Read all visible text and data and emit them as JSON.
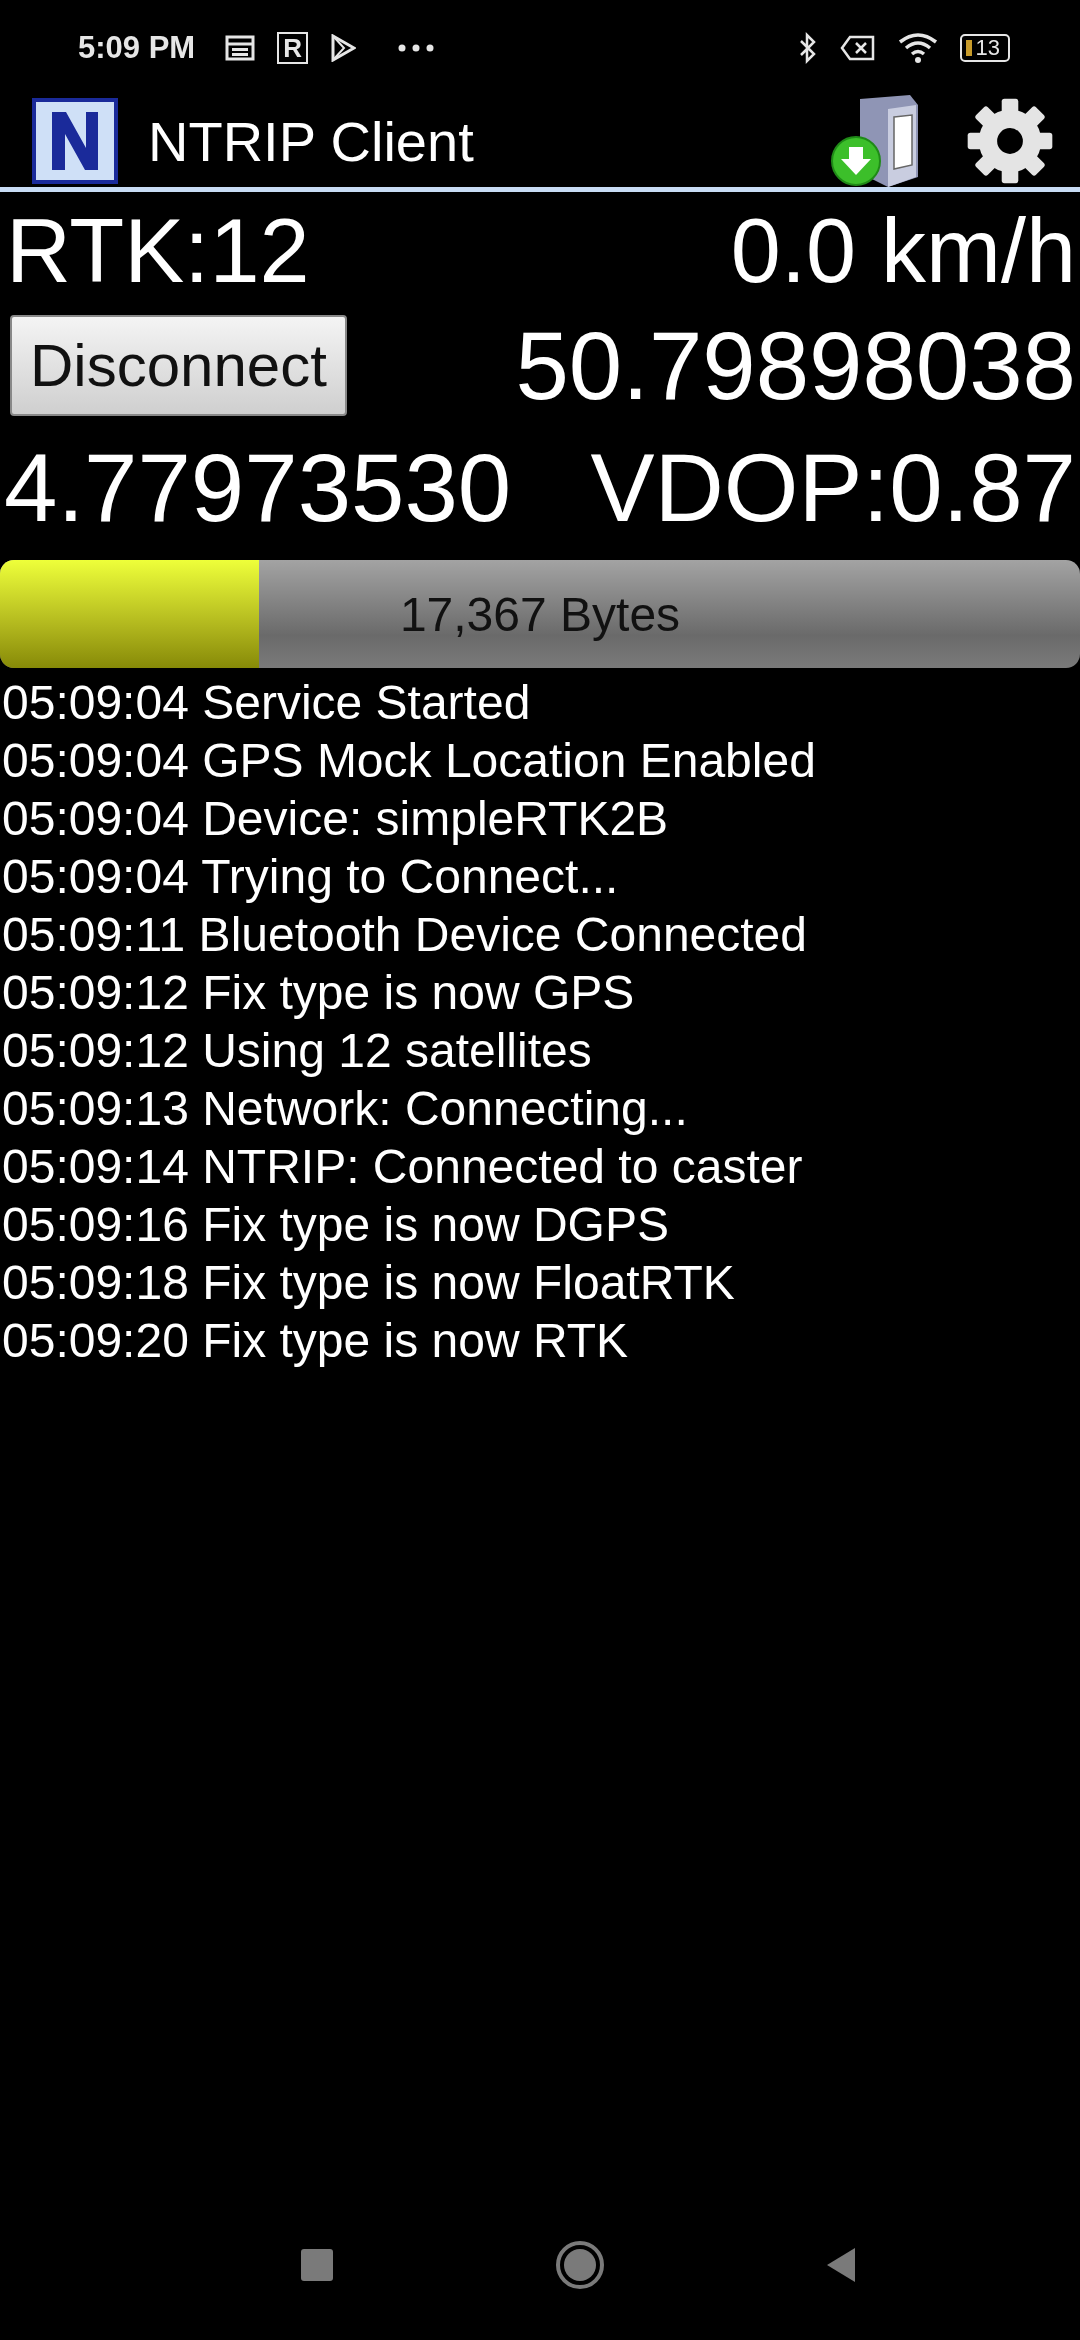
{
  "status_bar": {
    "time": "5:09 PM",
    "badge": "R",
    "battery": "13"
  },
  "app_bar": {
    "title": "NTRIP Client"
  },
  "fix": {
    "label": "RTK:12",
    "speed": "0.0 km/h"
  },
  "connect_button": "Disconnect",
  "latitude": "50.79898038",
  "longitude": "4.77973530",
  "vdop": "VDOP:0.87",
  "data_bar": {
    "level": 0.24,
    "label": "17,367 Bytes"
  },
  "log": [
    "05:09:04 Service Started",
    "05:09:04 GPS Mock Location Enabled",
    "05:09:04 Device: simpleRTK2B",
    "05:09:04 Trying to Connect...",
    "05:09:11 Bluetooth Device Connected",
    "05:09:12 Fix type is now GPS",
    "05:09:12 Using 12 satellites",
    "05:09:13 Network: Connecting...",
    "05:09:14 NTRIP: Connected to caster",
    "05:09:16 Fix type is now DGPS",
    "05:09:18 Fix type is now FloatRTK",
    "05:09:20 Fix type is now RTK"
  ]
}
